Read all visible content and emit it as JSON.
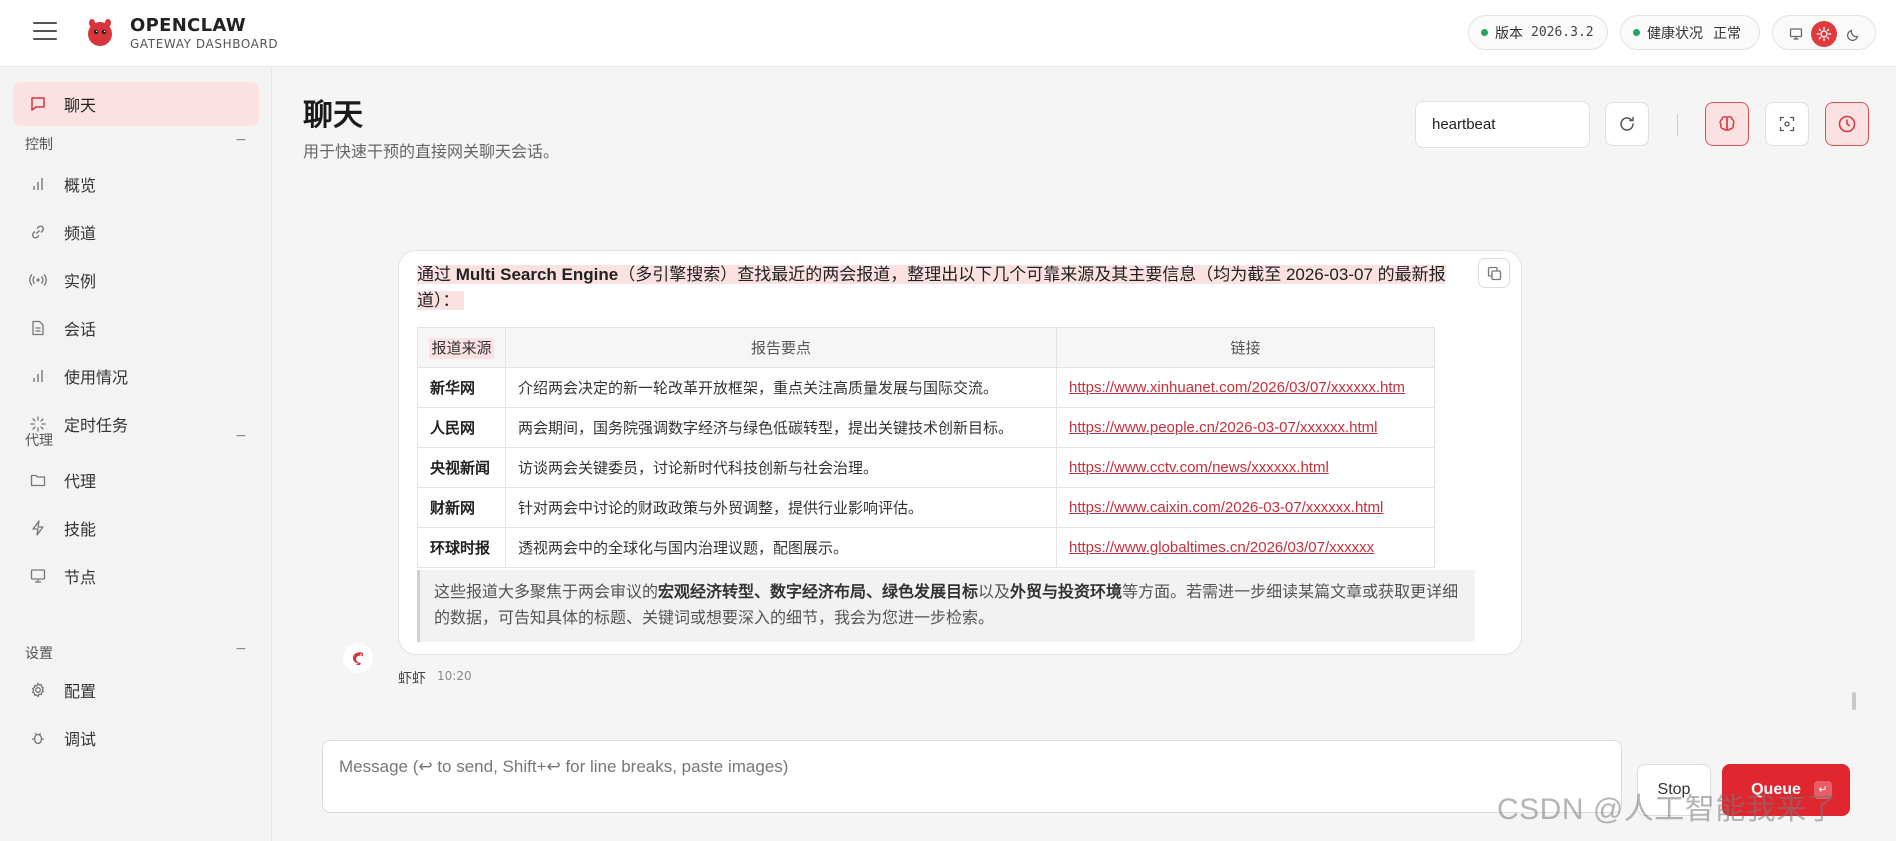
{
  "brand": {
    "title": "OPENCLAW",
    "subtitle": "GATEWAY DASHBOARD"
  },
  "status": {
    "version_label": "版本",
    "version_value": "2026.3.2",
    "health_label": "健康状况",
    "health_value": "正常",
    "status_color": "#22a55a"
  },
  "theme": {
    "active": "light",
    "accent": "#e0393e"
  },
  "sidebar": {
    "chat": "聊天",
    "sections": {
      "control": "控制",
      "agent": "代理",
      "settings": "设置",
      "collapse": "−"
    },
    "control_items": [
      "概览",
      "频道",
      "实例",
      "会话",
      "使用情况",
      "定时任务"
    ],
    "agent_items": [
      "代理",
      "技能",
      "节点"
    ],
    "settings_items": [
      "配置",
      "调试"
    ]
  },
  "page": {
    "title": "聊天",
    "subtitle": "用于快速干预的直接网关聊天会话。"
  },
  "session": {
    "value": "heartbeat"
  },
  "message": {
    "intro_pre": "通过 ",
    "intro_bold": "Multi Search Engine",
    "intro_post": "（多引擎搜索）查找最近的两会报道，整理出以下几个可靠来源及其主要信息（均为截至 2026-03-07 的最新报道）：",
    "table": {
      "headers": [
        "报道来源",
        "报告要点",
        "链接"
      ],
      "rows": [
        {
          "source": "新华网",
          "point": "介绍两会决定的新一轮改革开放框架，重点关注高质量发展与国际交流。",
          "link": "https://www.xinhuanet.com/2026/03/07/xxxxxx.htm"
        },
        {
          "source": "人民网",
          "point": "两会期间，国务院强调数字经济与绿色低碳转型，提出关键技术创新目标。",
          "link": "https://www.people.cn/2026-03-07/xxxxxx.html"
        },
        {
          "source": "央视新闻",
          "point": "访谈两会关键委员，讨论新时代科技创新与社会治理。",
          "link": "https://www.cctv.com/news/xxxxxx.html"
        },
        {
          "source": "财新网",
          "point": "针对两会中讨论的财政政策与外贸调整，提供行业影响评估。",
          "link": "https://www.caixin.com/2026-03-07/xxxxxx.html"
        },
        {
          "source": "环球时报",
          "point": "透视两会中的全球化与国内治理议题，配图展示。",
          "link": "https://www.globaltimes.cn/2026/03/07/xxxxxx"
        }
      ]
    },
    "summary": {
      "t1": "这些报道大多聚焦于两会审议的",
      "b1": "宏观经济转型、数字经济布局、绿色发展目标",
      "t2": "以及",
      "b2": "外贸与投资环境",
      "t3": "等方面。若需进一步细读某篇文章或获取更详细的数据，可告知具体的标题、关键词或想要深入的细节，我会为您进一步检索。"
    },
    "sender": "虾虾",
    "time": "10:20"
  },
  "composer": {
    "placeholder": "Message (↩ to send, Shift+↩ for line breaks, paste images)",
    "stop": "Stop",
    "queue": "Queue",
    "queue_key": "↵"
  },
  "watermark": "CSDN @人工智能我来了"
}
